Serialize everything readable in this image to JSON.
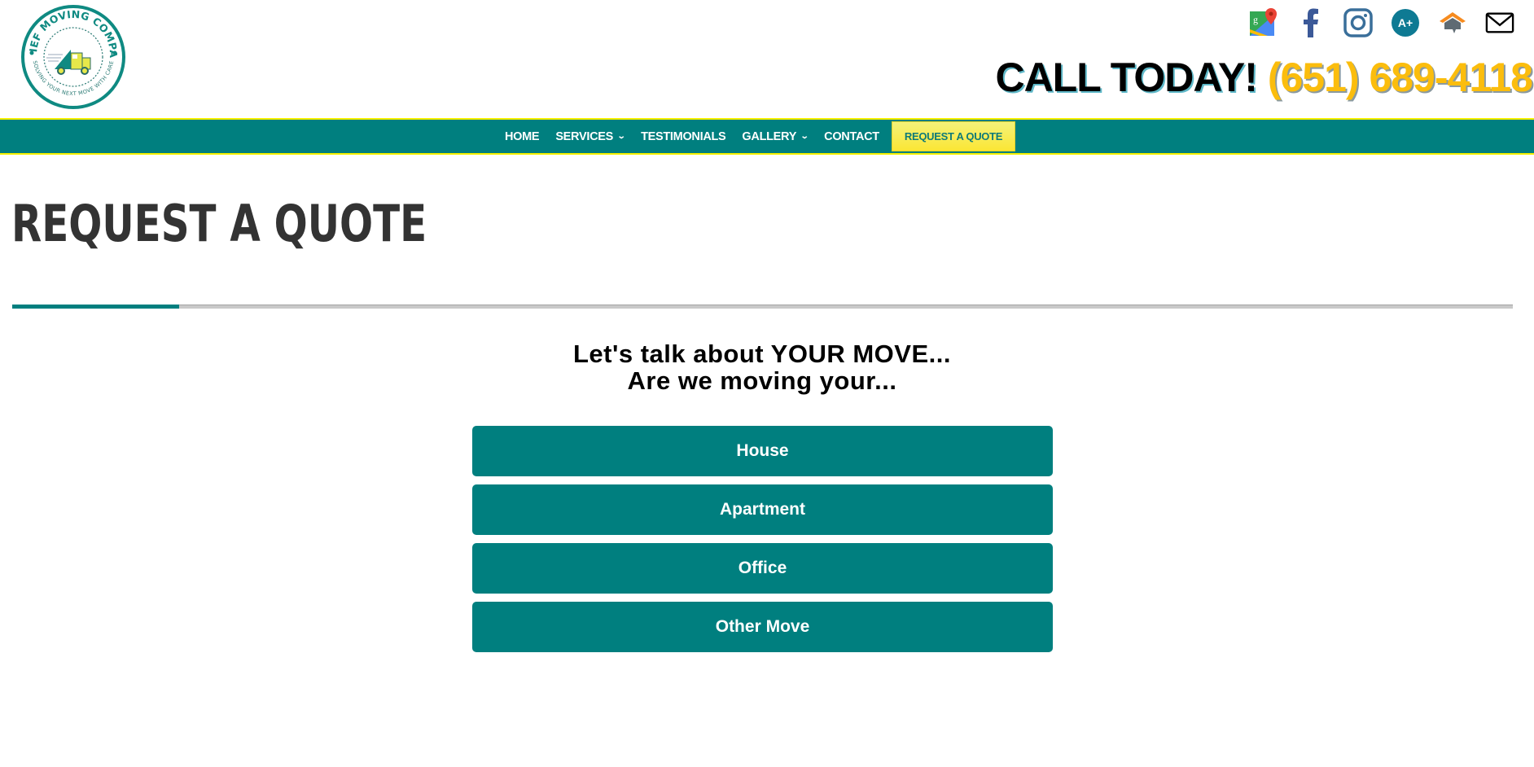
{
  "brand": {
    "name": "RELIEF MOVING COMPANY",
    "tagline": "SOLVING YOUR NEXT MOVE WITH CARE"
  },
  "header": {
    "call_label": "CALL TODAY!",
    "phone": "(651) 689-4118",
    "social_icons": [
      {
        "name": "google-maps-icon"
      },
      {
        "name": "facebook-icon"
      },
      {
        "name": "instagram-icon"
      },
      {
        "name": "bbb-a-plus-icon",
        "text": "A+"
      },
      {
        "name": "homeadvisor-icon"
      },
      {
        "name": "email-icon"
      }
    ]
  },
  "nav": {
    "items": [
      {
        "label": "HOME",
        "dropdown": false
      },
      {
        "label": "SERVICES",
        "dropdown": true
      },
      {
        "label": "TESTIMONIALS",
        "dropdown": false
      },
      {
        "label": "GALLERY",
        "dropdown": true
      },
      {
        "label": "CONTACT",
        "dropdown": false
      }
    ],
    "cta_label": "REQUEST A QUOTE"
  },
  "page": {
    "title": "REQUEST A QUOTE",
    "intro_line1": "Let's talk about YOUR MOVE...",
    "intro_line2": "Are we moving your...",
    "options": [
      {
        "label": "House"
      },
      {
        "label": "Apartment"
      },
      {
        "label": "Office"
      },
      {
        "label": "Other Move"
      }
    ]
  },
  "colors": {
    "primary_teal": "#007f7f",
    "accent_yellow": "#fbe634",
    "phone_gold": "#fbbd0d",
    "title_gray": "#333333"
  }
}
